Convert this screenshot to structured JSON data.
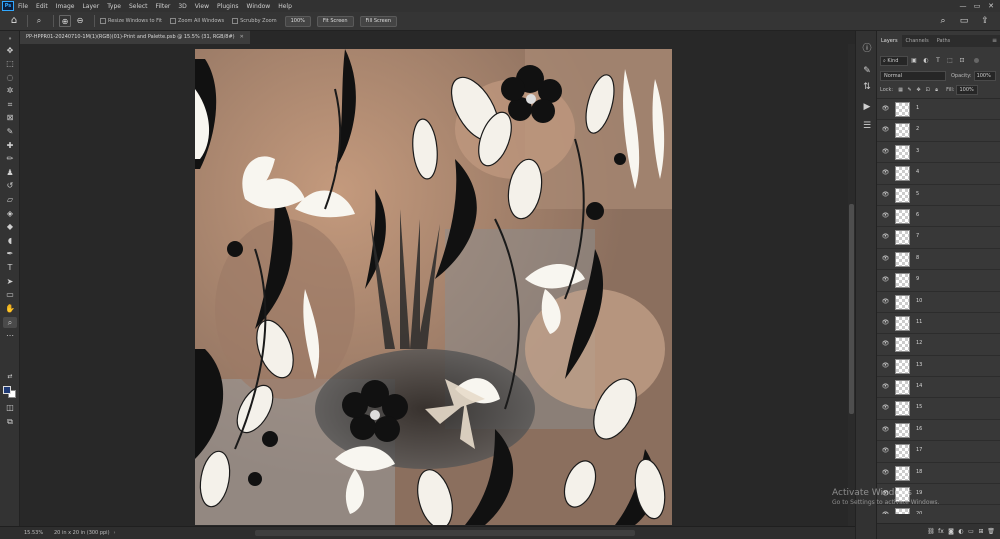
{
  "app": {
    "logo": "Ps"
  },
  "menu": [
    "File",
    "Edit",
    "Image",
    "Layer",
    "Type",
    "Select",
    "Filter",
    "3D",
    "View",
    "Plugins",
    "Window",
    "Help"
  ],
  "window_controls": [
    "—",
    "▭",
    "✕"
  ],
  "options_bar": {
    "resize_windows_label": "Resize Windows to Fit",
    "zoom_all_label": "Zoom All Windows",
    "scrubby_zoom_label": "Scrubby Zoom",
    "zoom_100_button": "100%",
    "fit_screen_button": "Fit Screen",
    "fill_screen_button": "Fill Screen"
  },
  "document": {
    "tab_title": "PP-HPPR01-20240710-1M(1)(RGB)(01)-Print and Palette.psb @ 15.5% (31, RGB/8#)",
    "zoom_status": "15.53%",
    "doc_info": "20 in x 20 in (300 ppi)"
  },
  "colors": {
    "foreground": "#1f3a75",
    "background": "#ffffff",
    "ui_dark": "#282828",
    "panel": "#383838"
  },
  "layers_panel": {
    "tabs": [
      "Layers",
      "Channels",
      "Paths"
    ],
    "kind_filter": "Kind",
    "blend_mode": "Normal",
    "opacity_label": "Opacity:",
    "opacity_value": "100%",
    "lock_label": "Lock:",
    "fill_label": "Fill:",
    "fill_value": "100%",
    "layers": [
      {
        "name": "1"
      },
      {
        "name": "2"
      },
      {
        "name": "3"
      },
      {
        "name": "4"
      },
      {
        "name": "5"
      },
      {
        "name": "6"
      },
      {
        "name": "7"
      },
      {
        "name": "8"
      },
      {
        "name": "9"
      },
      {
        "name": "10"
      },
      {
        "name": "11"
      },
      {
        "name": "12"
      },
      {
        "name": "13"
      },
      {
        "name": "14"
      },
      {
        "name": "15"
      },
      {
        "name": "16"
      },
      {
        "name": "17"
      },
      {
        "name": "18"
      },
      {
        "name": "19"
      },
      {
        "name": "20"
      }
    ]
  },
  "watermark": {
    "title": "Activate Windows",
    "subtitle": "Go to Settings to activate Windows."
  }
}
